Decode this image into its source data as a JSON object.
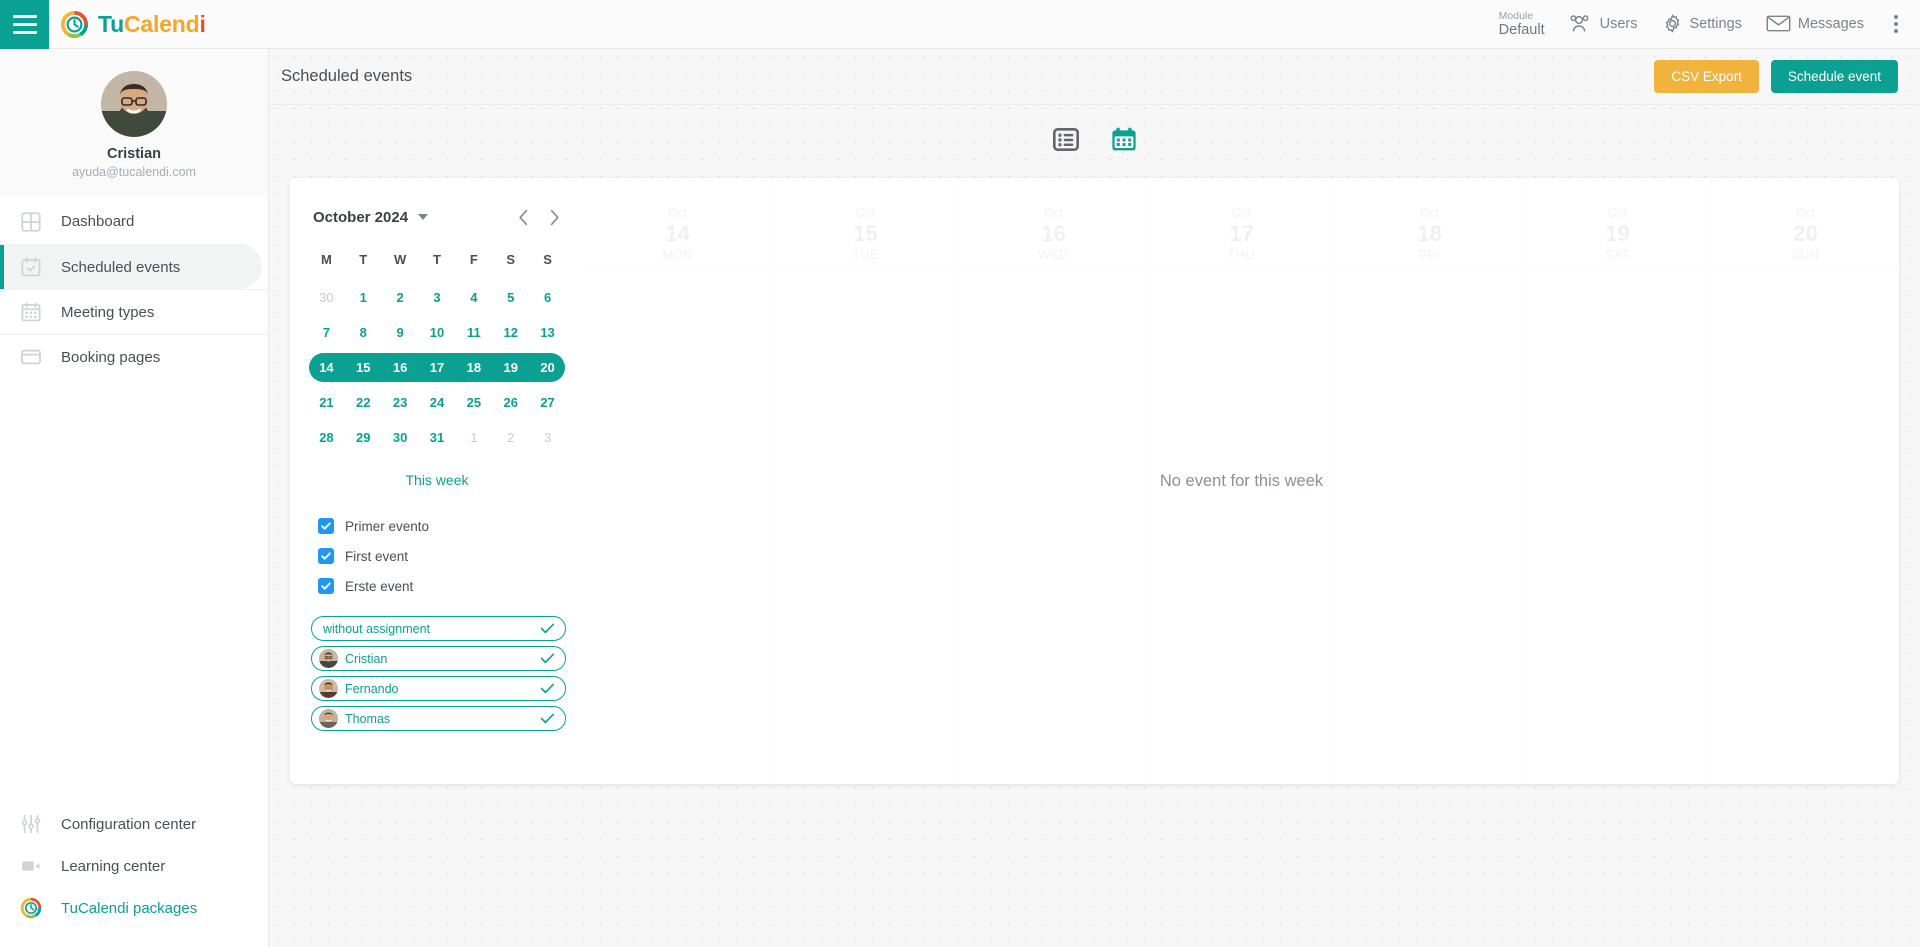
{
  "brand": {
    "part1": "Tu",
    "part2": "Calend",
    "part3": "i",
    "logo_icon": "tucalendi-logo-icon",
    "hamburger_icon": "hamburger-menu-icon"
  },
  "topnav": {
    "module_label": "Module",
    "module_value": "Default",
    "users": "Users",
    "settings": "Settings",
    "messages": "Messages",
    "users_icon": "users-icon",
    "settings_icon": "gear-icon",
    "messages_icon": "envelope-icon",
    "kebab_icon": "more-vertical-icon"
  },
  "sidebar": {
    "profile": {
      "name": "Cristian",
      "email": "ayuda@tucalendi.com",
      "avatar_icon": "user-avatar"
    },
    "items": [
      {
        "label": "Dashboard",
        "icon": "grid-icon",
        "active": false
      },
      {
        "label": "Scheduled events",
        "icon": "calendar-check-icon",
        "active": true
      },
      {
        "label": "Meeting types",
        "icon": "calendar-grid-icon",
        "active": false
      },
      {
        "label": "Booking pages",
        "icon": "window-icon",
        "active": false
      }
    ],
    "bottom_items": [
      {
        "label": "Configuration center",
        "icon": "sliders-icon"
      },
      {
        "label": "Learning center",
        "icon": "video-camera-icon"
      },
      {
        "label": "TuCalendi packages",
        "icon": "tucalendi-logo-icon"
      }
    ]
  },
  "header": {
    "title": "Scheduled events",
    "csv_export": "CSV Export",
    "schedule_event": "Schedule event"
  },
  "view_toggle": {
    "list_icon": "list-view-icon",
    "calendar_icon": "calendar-view-icon",
    "active": "calendar"
  },
  "calendar": {
    "month_label": "October 2024",
    "caret_icon": "chevron-down-icon",
    "prev_icon": "chevron-left-icon",
    "next_icon": "chevron-right-icon",
    "dow": [
      "M",
      "T",
      "W",
      "T",
      "F",
      "S",
      "S"
    ],
    "weeks": [
      {
        "selected": false,
        "days": [
          {
            "n": "30",
            "muted": true
          },
          {
            "n": "1",
            "muted": false
          },
          {
            "n": "2",
            "muted": false
          },
          {
            "n": "3",
            "muted": false
          },
          {
            "n": "4",
            "muted": false
          },
          {
            "n": "5",
            "muted": false
          },
          {
            "n": "6",
            "muted": false
          }
        ]
      },
      {
        "selected": false,
        "days": [
          {
            "n": "7",
            "muted": false
          },
          {
            "n": "8",
            "muted": false
          },
          {
            "n": "9",
            "muted": false
          },
          {
            "n": "10",
            "muted": false
          },
          {
            "n": "11",
            "muted": false
          },
          {
            "n": "12",
            "muted": false
          },
          {
            "n": "13",
            "muted": false
          }
        ]
      },
      {
        "selected": true,
        "days": [
          {
            "n": "14",
            "muted": false
          },
          {
            "n": "15",
            "muted": false
          },
          {
            "n": "16",
            "muted": false
          },
          {
            "n": "17",
            "muted": false
          },
          {
            "n": "18",
            "muted": false
          },
          {
            "n": "19",
            "muted": false
          },
          {
            "n": "20",
            "muted": false
          }
        ]
      },
      {
        "selected": false,
        "days": [
          {
            "n": "21",
            "muted": false
          },
          {
            "n": "22",
            "muted": false
          },
          {
            "n": "23",
            "muted": false
          },
          {
            "n": "24",
            "muted": false
          },
          {
            "n": "25",
            "muted": false
          },
          {
            "n": "26",
            "muted": false
          },
          {
            "n": "27",
            "muted": false
          }
        ]
      },
      {
        "selected": false,
        "days": [
          {
            "n": "28",
            "muted": false
          },
          {
            "n": "29",
            "muted": false
          },
          {
            "n": "30",
            "muted": false
          },
          {
            "n": "31",
            "muted": false
          },
          {
            "n": "1",
            "muted": true
          },
          {
            "n": "2",
            "muted": true
          },
          {
            "n": "3",
            "muted": true
          }
        ]
      }
    ],
    "this_week": "This week"
  },
  "event_filters": [
    {
      "label": "Primer evento",
      "checked": true
    },
    {
      "label": "First event",
      "checked": true
    },
    {
      "label": "Erste event",
      "checked": true
    }
  ],
  "user_filters": [
    {
      "label": "without assignment",
      "has_avatar": false,
      "checked": true
    },
    {
      "label": "Cristian",
      "has_avatar": true,
      "checked": true
    },
    {
      "label": "Fernando",
      "has_avatar": true,
      "checked": true
    },
    {
      "label": "Thomas",
      "has_avatar": true,
      "checked": true
    }
  ],
  "week_days": [
    {
      "month": "Oct",
      "num": "14",
      "dow": "MON"
    },
    {
      "month": "Oct",
      "num": "15",
      "dow": "TUE"
    },
    {
      "month": "Oct",
      "num": "16",
      "dow": "WED"
    },
    {
      "month": "Oct",
      "num": "17",
      "dow": "THU"
    },
    {
      "month": "Oct",
      "num": "18",
      "dow": "FRI"
    },
    {
      "month": "Oct",
      "num": "19",
      "dow": "SAT"
    },
    {
      "month": "Oct",
      "num": "20",
      "dow": "SUN"
    }
  ],
  "empty_state": "No event for this week",
  "colors": {
    "teal": "#0aa193",
    "amber": "#f2b33d",
    "blue_checkbox": "#2196f3",
    "orange": "#e8502a"
  }
}
